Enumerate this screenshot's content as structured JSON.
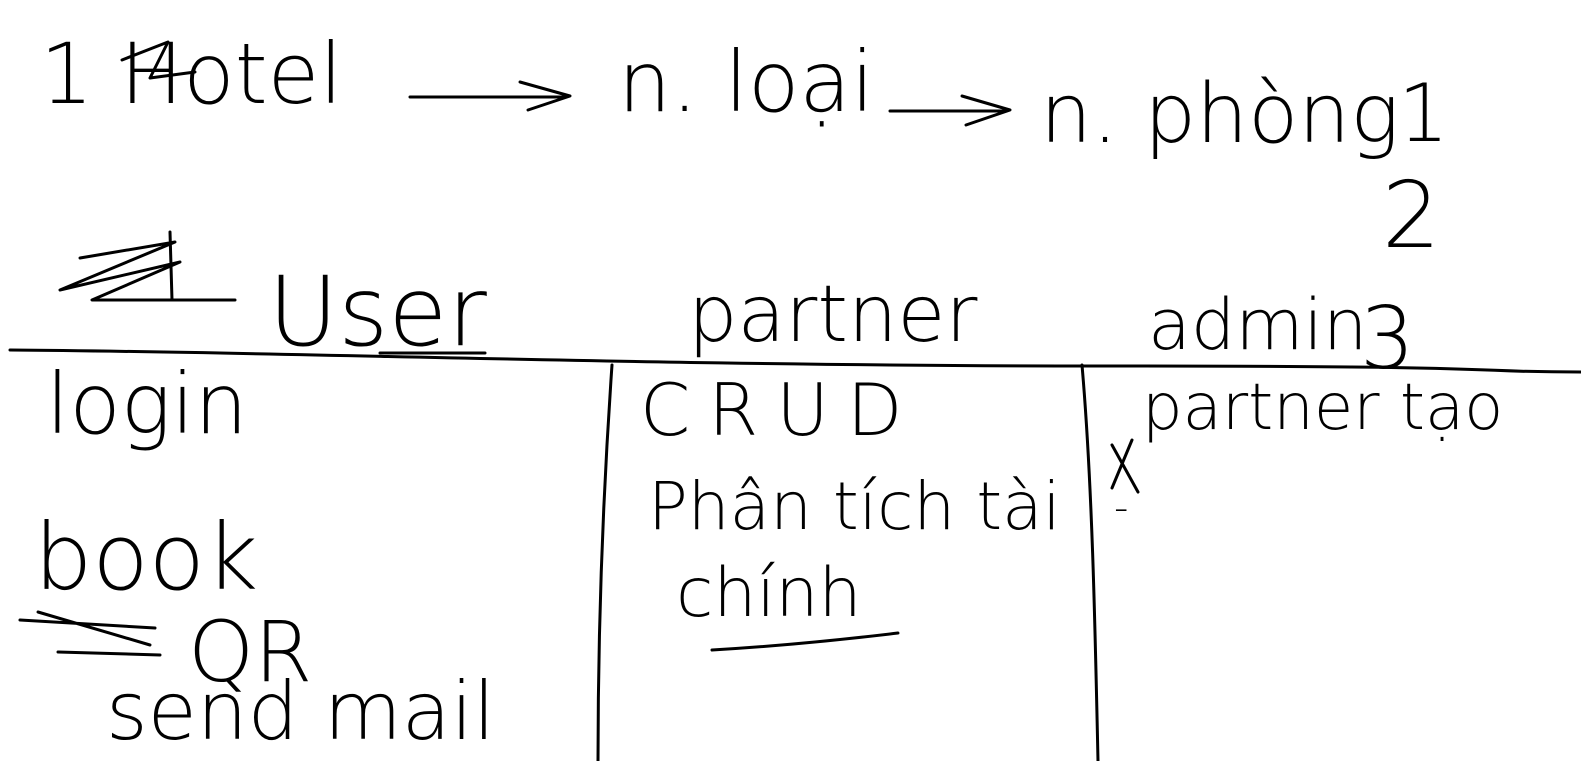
{
  "header": {
    "hotel": "1 Hotel",
    "loai": "n. loại",
    "phong": "n. phòng",
    "num1": "1",
    "num2": "2",
    "num3": "3"
  },
  "columns": {
    "user": {
      "title": "User",
      "items": [
        "login",
        "book",
        "QR",
        "send mail"
      ]
    },
    "partner": {
      "title": "partner",
      "items": [
        "CRUD",
        "Phân tích tài",
        "chính"
      ]
    },
    "admin": {
      "title": "admin",
      "items": [
        "partner tạo",
        "x",
        "-"
      ]
    }
  },
  "colors": {
    "ink": "#000000",
    "background": "#ffffff"
  }
}
